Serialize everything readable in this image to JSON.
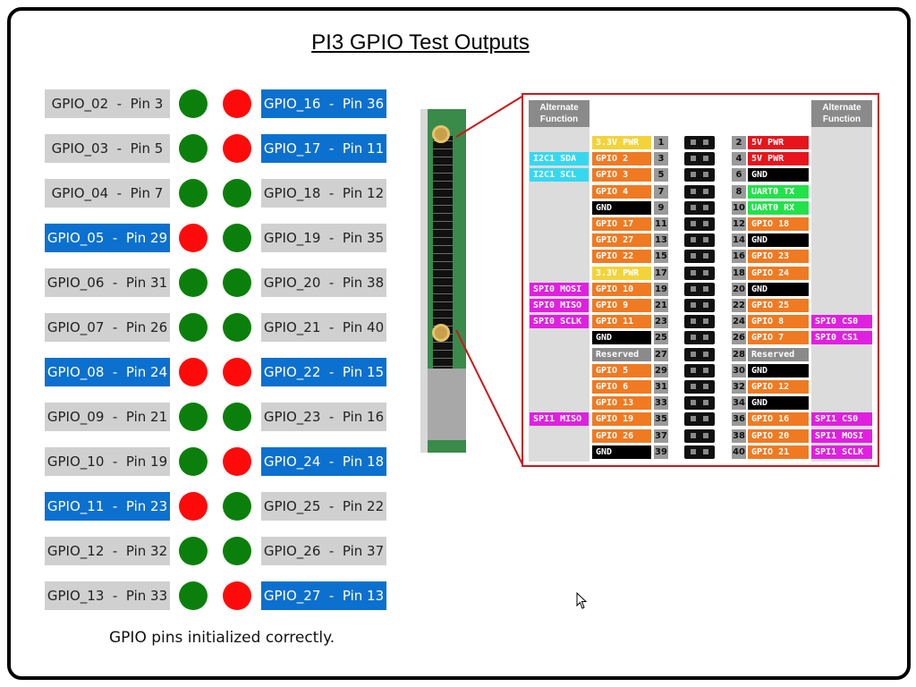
{
  "title": "PI3 GPIO Test Outputs",
  "status": "GPIO pins initialized correctly.",
  "colors": {
    "gray_label": "#d0d0d0",
    "blue_label": "#0c70cf",
    "led_green": "#0b7f0b",
    "led_red": "#ff0a0a"
  },
  "rows": [
    {
      "left": {
        "text": "GPIO_02  -  Pin 3",
        "style": "gray"
      },
      "led_left": "green",
      "led_right": "red",
      "right": {
        "text": "GPIO_16  -  Pin 36",
        "style": "blue"
      }
    },
    {
      "left": {
        "text": "GPIO_03  -  Pin 5",
        "style": "gray"
      },
      "led_left": "green",
      "led_right": "red",
      "right": {
        "text": "GPIO_17  -  Pin 11",
        "style": "blue"
      }
    },
    {
      "left": {
        "text": "GPIO_04  -  Pin 7",
        "style": "gray"
      },
      "led_left": "green",
      "led_right": "green",
      "right": {
        "text": "GPIO_18  -  Pin 12",
        "style": "gray"
      }
    },
    {
      "left": {
        "text": "GPIO_05  -  Pin 29",
        "style": "blue"
      },
      "led_left": "red",
      "led_right": "green",
      "right": {
        "text": "GPIO_19  -  Pin 35",
        "style": "gray"
      }
    },
    {
      "left": {
        "text": "GPIO_06  -  Pin 31",
        "style": "gray"
      },
      "led_left": "green",
      "led_right": "green",
      "right": {
        "text": "GPIO_20  -  Pin 38",
        "style": "gray"
      }
    },
    {
      "left": {
        "text": "GPIO_07  -  Pin 26",
        "style": "gray"
      },
      "led_left": "green",
      "led_right": "green",
      "right": {
        "text": "GPIO_21  -  Pin 40",
        "style": "gray"
      }
    },
    {
      "left": {
        "text": "GPIO_08  -  Pin 24",
        "style": "blue"
      },
      "led_left": "red",
      "led_right": "red",
      "right": {
        "text": "GPIO_22  -  Pin 15",
        "style": "blue"
      }
    },
    {
      "left": {
        "text": "GPIO_09  -  Pin 21",
        "style": "gray"
      },
      "led_left": "green",
      "led_right": "green",
      "right": {
        "text": "GPIO_23  -  Pin 16",
        "style": "gray"
      }
    },
    {
      "left": {
        "text": "GPIO_10  -  Pin 19",
        "style": "gray"
      },
      "led_left": "green",
      "led_right": "red",
      "right": {
        "text": "GPIO_24  -  Pin 18",
        "style": "blue"
      }
    },
    {
      "left": {
        "text": "GPIO_11  -  Pin 23",
        "style": "blue"
      },
      "led_left": "red",
      "led_right": "green",
      "right": {
        "text": "GPIO_25  -  Pin 22",
        "style": "gray"
      }
    },
    {
      "left": {
        "text": "GPIO_12  -  Pin 32",
        "style": "gray"
      },
      "led_left": "green",
      "led_right": "green",
      "right": {
        "text": "GPIO_26  -  Pin 37",
        "style": "gray"
      }
    },
    {
      "left": {
        "text": "GPIO_13  -  Pin 33",
        "style": "gray"
      },
      "led_left": "green",
      "led_right": "red",
      "right": {
        "text": "GPIO_27  -  Pin 13",
        "style": "blue"
      }
    }
  ],
  "pinout": {
    "alt_header": "Alternate Function",
    "tag_colors": {
      "power33": "#f3d33a",
      "power5": "#e8141c",
      "gpio": "#f07a22",
      "gnd": "#000000",
      "uart": "#22e24a",
      "i2c": "#36d8f0",
      "spi": "#e020e0",
      "reserved": "#8a8a8a"
    },
    "rows": [
      {
        "lalt": "",
        "lname": "3.3V PWR",
        "ltype": "power33",
        "lnum": "1",
        "rnum": "2",
        "rname": "5V PWR",
        "rtype": "power5",
        "ralt": ""
      },
      {
        "lalt": "I2C1 SDA",
        "lname": "GPIO 2",
        "ltype": "gpio",
        "lnum": "3",
        "rnum": "4",
        "rname": "5V PWR",
        "rtype": "power5",
        "ralt": ""
      },
      {
        "lalt": "I2C1 SCL",
        "lname": "GPIO 3",
        "ltype": "gpio",
        "lnum": "5",
        "rnum": "6",
        "rname": "GND",
        "rtype": "gnd",
        "ralt": ""
      },
      {
        "lalt": "",
        "lname": "GPIO 4",
        "ltype": "gpio",
        "lnum": "7",
        "rnum": "8",
        "rname": "UART0 TX",
        "rtype": "uart",
        "ralt": ""
      },
      {
        "lalt": "",
        "lname": "GND",
        "ltype": "gnd",
        "lnum": "9",
        "rnum": "10",
        "rname": "UART0 RX",
        "rtype": "uart",
        "ralt": ""
      },
      {
        "lalt": "",
        "lname": "GPIO 17",
        "ltype": "gpio",
        "lnum": "11",
        "rnum": "12",
        "rname": "GPIO 18",
        "rtype": "gpio",
        "ralt": ""
      },
      {
        "lalt": "",
        "lname": "GPIO 27",
        "ltype": "gpio",
        "lnum": "13",
        "rnum": "14",
        "rname": "GND",
        "rtype": "gnd",
        "ralt": ""
      },
      {
        "lalt": "",
        "lname": "GPIO 22",
        "ltype": "gpio",
        "lnum": "15",
        "rnum": "16",
        "rname": "GPIO 23",
        "rtype": "gpio",
        "ralt": ""
      },
      {
        "lalt": "",
        "lname": "3.3V PWR",
        "ltype": "power33",
        "lnum": "17",
        "rnum": "18",
        "rname": "GPIO 24",
        "rtype": "gpio",
        "ralt": ""
      },
      {
        "lalt": "SPI0 MOSI",
        "lname": "GPIO 10",
        "ltype": "gpio",
        "lnum": "19",
        "rnum": "20",
        "rname": "GND",
        "rtype": "gnd",
        "ralt": ""
      },
      {
        "lalt": "SPI0 MISO",
        "lname": "GPIO 9",
        "ltype": "gpio",
        "lnum": "21",
        "rnum": "22",
        "rname": "GPIO 25",
        "rtype": "gpio",
        "ralt": ""
      },
      {
        "lalt": "SPI0 SCLK",
        "lname": "GPIO 11",
        "ltype": "gpio",
        "lnum": "23",
        "rnum": "24",
        "rname": "GPIO 8",
        "rtype": "gpio",
        "ralt": "SPI0 CS0"
      },
      {
        "lalt": "",
        "lname": "GND",
        "ltype": "gnd",
        "lnum": "25",
        "rnum": "26",
        "rname": "GPIO 7",
        "rtype": "gpio",
        "ralt": "SPI0 CS1"
      },
      {
        "lalt": "",
        "lname": "Reserved",
        "ltype": "reserved",
        "lnum": "27",
        "rnum": "28",
        "rname": "Reserved",
        "rtype": "reserved",
        "ralt": ""
      },
      {
        "lalt": "",
        "lname": "GPIO 5",
        "ltype": "gpio",
        "lnum": "29",
        "rnum": "30",
        "rname": "GND",
        "rtype": "gnd",
        "ralt": ""
      },
      {
        "lalt": "",
        "lname": "GPIO 6",
        "ltype": "gpio",
        "lnum": "31",
        "rnum": "32",
        "rname": "GPIO 12",
        "rtype": "gpio",
        "ralt": ""
      },
      {
        "lalt": "",
        "lname": "GPIO 13",
        "ltype": "gpio",
        "lnum": "33",
        "rnum": "34",
        "rname": "GND",
        "rtype": "gnd",
        "ralt": ""
      },
      {
        "lalt": "SPI1 MISO",
        "lname": "GPIO 19",
        "ltype": "gpio",
        "lnum": "35",
        "rnum": "36",
        "rname": "GPIO 16",
        "rtype": "gpio",
        "ralt": "SPI1 CS0"
      },
      {
        "lalt": "",
        "lname": "GPIO 26",
        "ltype": "gpio",
        "lnum": "37",
        "rnum": "38",
        "rname": "GPIO 20",
        "rtype": "gpio",
        "ralt": "SPI1 MOSI"
      },
      {
        "lalt": "",
        "lname": "GND",
        "ltype": "gnd",
        "lnum": "39",
        "rnum": "40",
        "rname": "GPIO 21",
        "rtype": "gpio",
        "ralt": "SPI1 SCLK"
      }
    ]
  }
}
